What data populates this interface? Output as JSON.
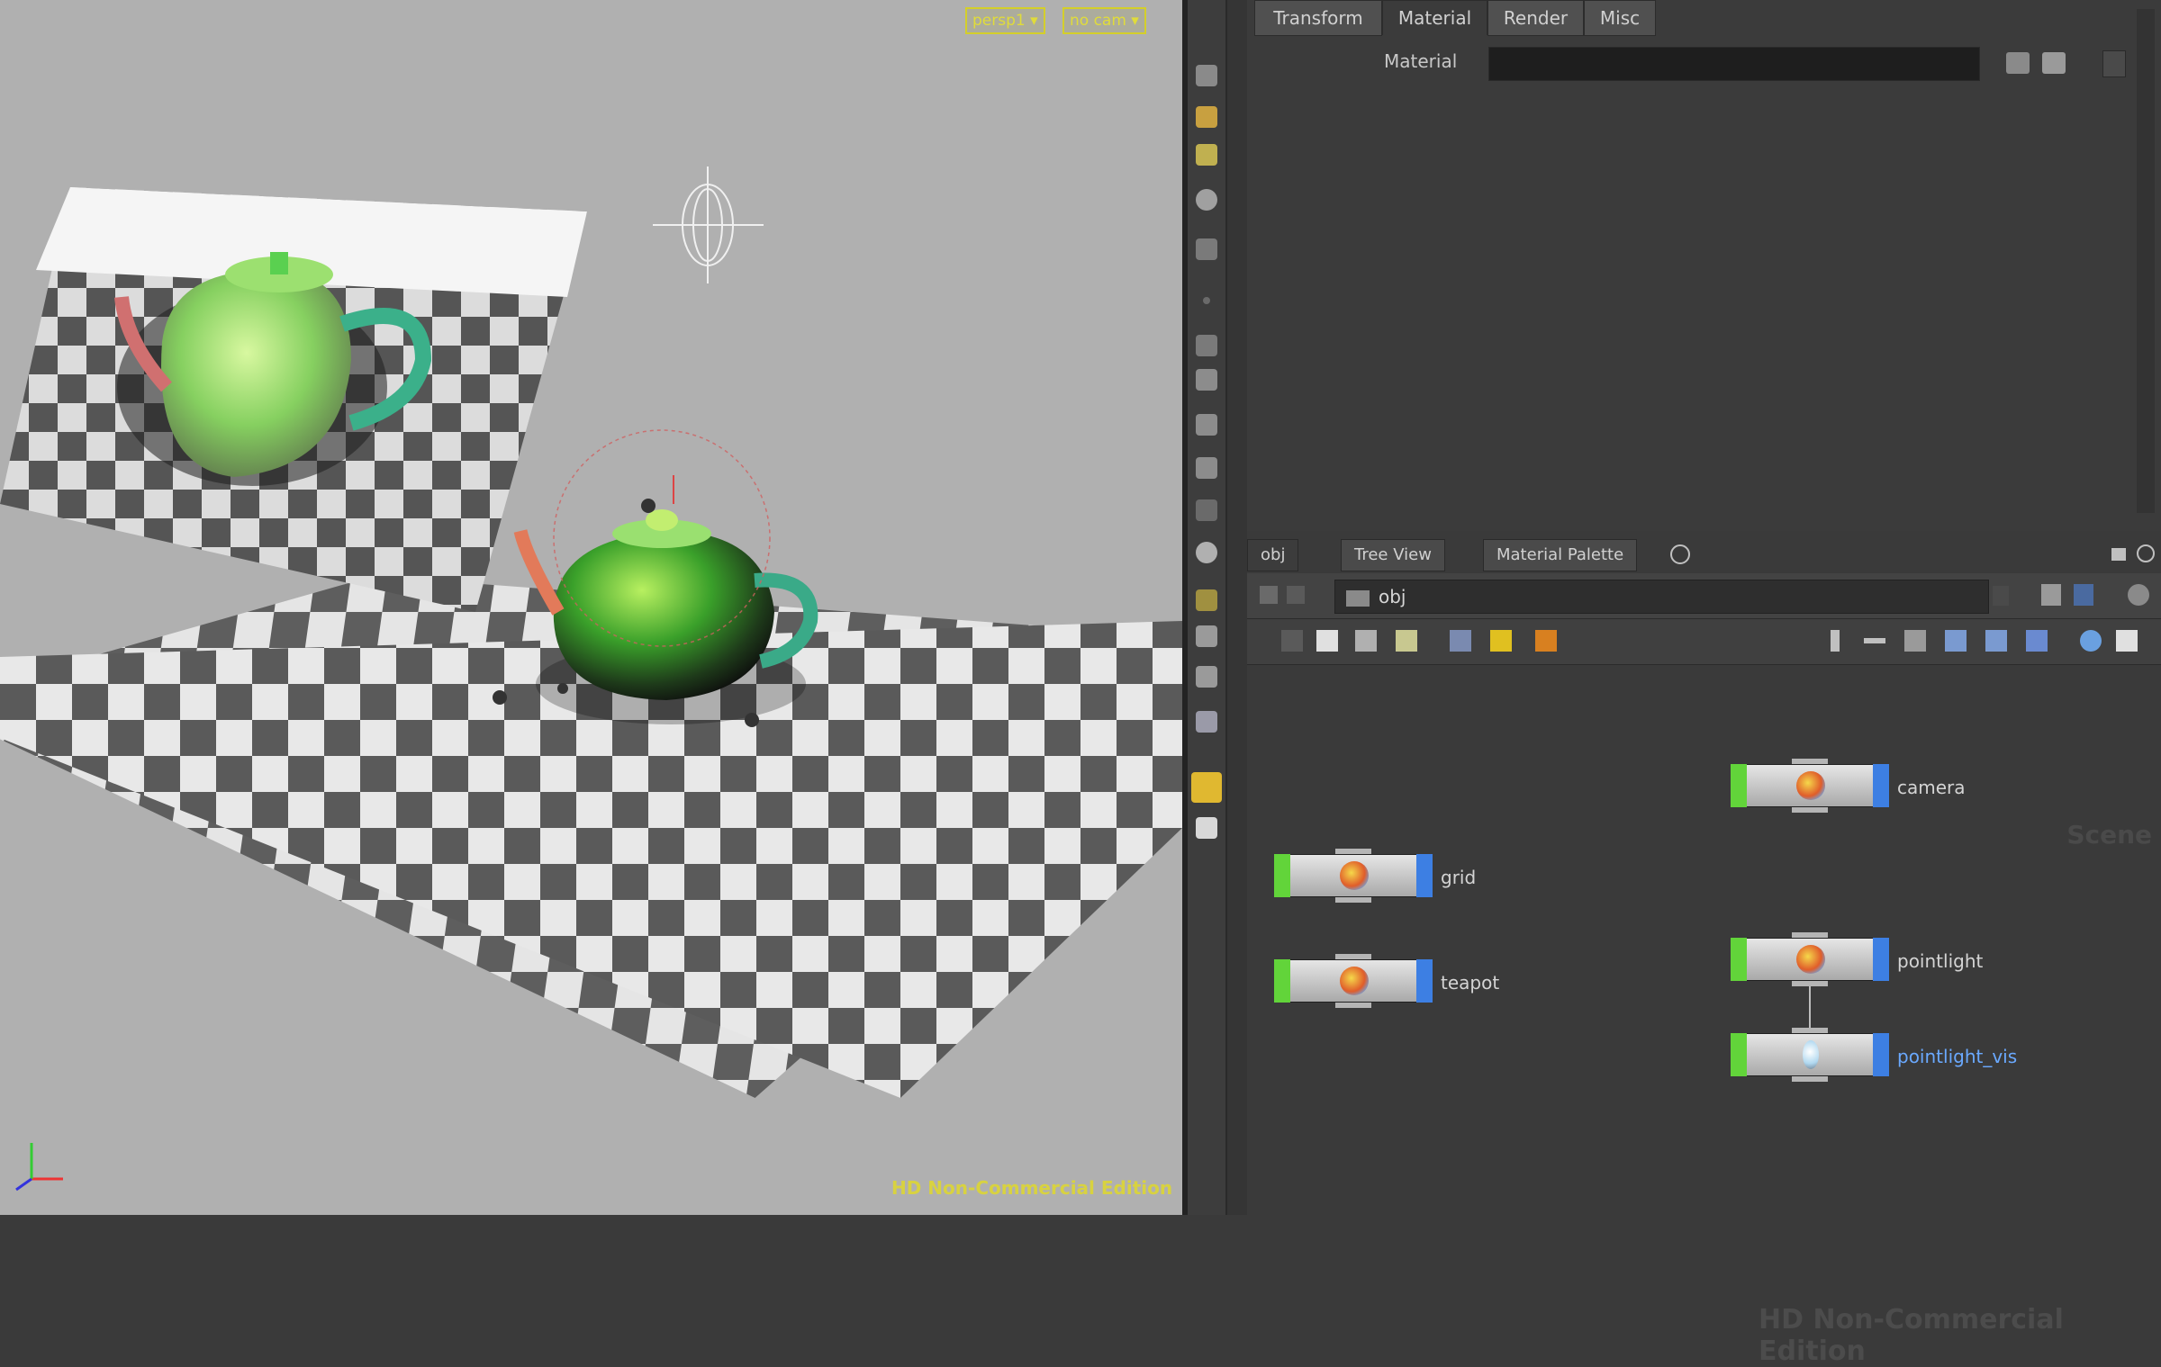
{
  "viewport": {
    "camera_menu": "persp1 ▾",
    "cam_menu": "no cam ▾",
    "watermark": "HD Non-Commercial Edition"
  },
  "params": {
    "tabs": [
      "Transform",
      "Material",
      "Render",
      "Misc"
    ],
    "active_tab": "Material",
    "material_label": "Material",
    "material_value": ""
  },
  "network": {
    "tabs": [
      "obj",
      "Tree View",
      "Material Palette"
    ],
    "path": "obj",
    "context_label": "Scene",
    "watermark": "HD Non-Commercial Edition",
    "nodes": [
      {
        "name": "camera",
        "selected": false
      },
      {
        "name": "grid",
        "selected": false
      },
      {
        "name": "pointlight",
        "selected": false
      },
      {
        "name": "teapot",
        "selected": false
      },
      {
        "name": "pointlight_vis",
        "selected": true
      }
    ]
  },
  "colors": {
    "accent_yellow": "#d4cf2a",
    "node_green": "#62d43a",
    "node_blue": "#3d7fe3",
    "selected_text": "#6aa9ff"
  }
}
